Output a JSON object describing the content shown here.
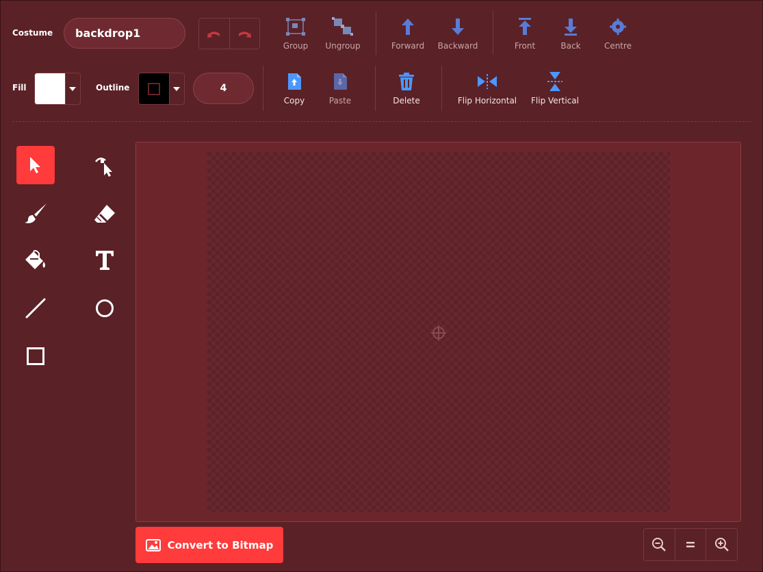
{
  "costume": {
    "label": "Costume",
    "name_value": "backdrop1"
  },
  "toolbar_row1": {
    "group": "Group",
    "ungroup": "Ungroup",
    "forward": "Forward",
    "backward": "Backward",
    "front": "Front",
    "back": "Back",
    "centre": "Centre"
  },
  "fill": {
    "label": "Fill",
    "color": "#ffffff"
  },
  "outline": {
    "label": "Outline",
    "color": "#000000",
    "width": "4"
  },
  "toolbar_row2": {
    "copy": "Copy",
    "paste": "Paste",
    "delete": "Delete",
    "flip_horizontal": "Flip Horizontal",
    "flip_vertical": "Flip Vertical"
  },
  "tools": [
    "select",
    "reshape",
    "brush",
    "eraser",
    "fill",
    "text",
    "line",
    "circle",
    "rectangle"
  ],
  "convert_button": "Convert to Bitmap",
  "colors": {
    "accent": "#ff3b3b",
    "icon_blue": "#4c97ff",
    "background": "#5a2127"
  }
}
